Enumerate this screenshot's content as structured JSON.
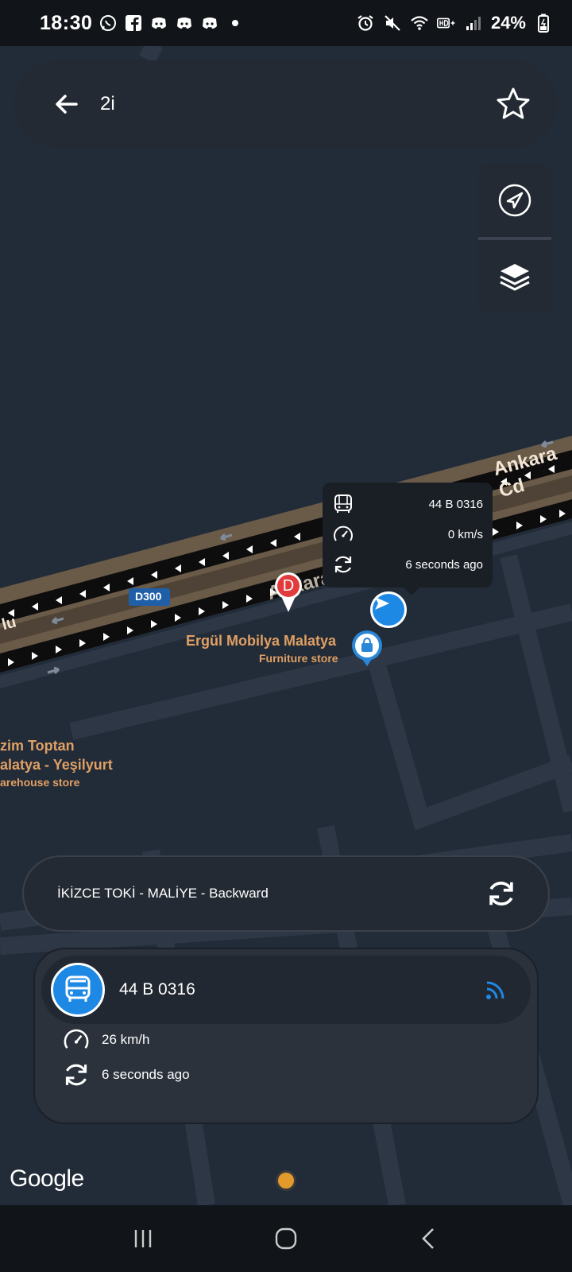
{
  "status_bar": {
    "time": "18:30",
    "battery": "24%",
    "left_icons": [
      "whatsapp-icon",
      "facebook-icon",
      "discord-icon",
      "discord-icon",
      "discord-icon",
      "dot-icon"
    ],
    "right_icons": [
      "alarm-icon",
      "mute-icon",
      "wifi-icon",
      "hd-icon",
      "signal-icon",
      "battery-icon"
    ]
  },
  "search": {
    "query": "2i"
  },
  "map": {
    "road_shield": "D300",
    "street_label_1": "Ankara Cd",
    "street_label_2": "Ankara C",
    "street_label_3": "lu",
    "poi_ergul_name": "Ergül Mobilya Malatya",
    "poi_ergul_type": "Furniture store",
    "poi_other_line1": "zim Toptan",
    "poi_other_line2": "alatya - Yeşilyurt",
    "poi_other_type": "arehouse store",
    "marker_d_label": "D"
  },
  "popup": {
    "plate": "44 B 0316",
    "speed": "0 km/s",
    "updated": "6 seconds ago"
  },
  "route": {
    "label": "İKİZCE TOKİ - MALİYE  - Backward"
  },
  "vehicle": {
    "plate": "44 B 0316",
    "speed": "26 km/h",
    "updated": "6 seconds ago"
  },
  "google_logo": "Google",
  "colors": {
    "accent_blue": "#1e88e5",
    "card_bg": "#232a33",
    "map_bg": "#222b38",
    "road_brown": "#6a5a48",
    "poi_orange": "#e0a064"
  }
}
